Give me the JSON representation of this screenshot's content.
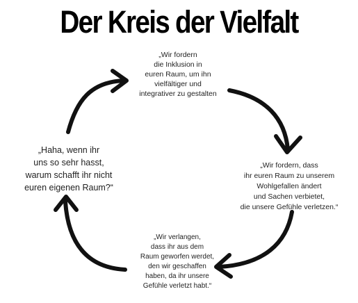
{
  "title": "Der Kreis der Vielfalt",
  "colors": {
    "arrow": "#111111",
    "text": "#222222",
    "title": "#000000",
    "background": "#ffffff"
  },
  "nodes": {
    "top": "„Wir fordern\ndie Inklusion in\neuren Raum, um ihn\nvielfältiger und\nintegrativer zu gestalten",
    "right": "„Wir fordern, dass\nihr euren Raum zu unserem\nWohlgefallen ändert\nund Sachen verbietet,\ndie unsere Gefühle verletzen.“",
    "bottom": "„Wir verlangen,\ndass ihr aus dem\nRaum geworfen werdet,\nden wir geschaffen\nhaben, da ihr unsere\nGefühle verletzt habt.“",
    "left": "„Haha, wenn ihr\nuns so sehr hasst,\nwarum schafft ihr nicht\neuren eigenen Raum?“"
  },
  "arrows": [
    "arrow-top-left",
    "arrow-top-right",
    "arrow-bottom-right",
    "arrow-bottom-left"
  ]
}
